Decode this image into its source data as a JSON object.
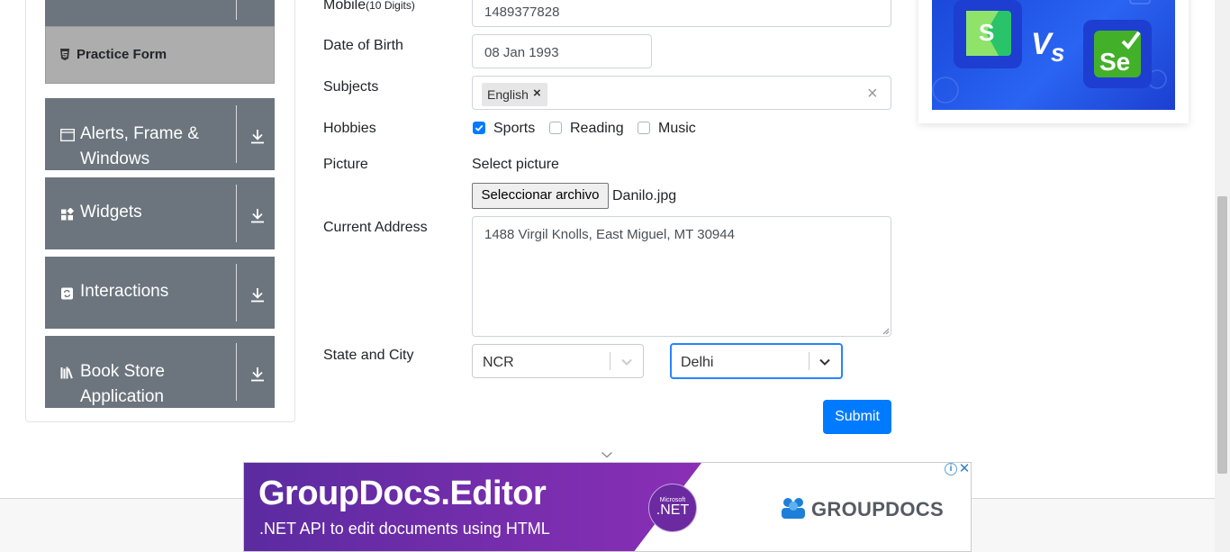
{
  "sidebar": {
    "practice_form_label": "Practice Form",
    "groups": [
      {
        "label_line1": "Alerts, Frame &",
        "label_line2": "Windows",
        "icon": "window-icon"
      },
      {
        "label_line1": "Widgets",
        "icon": "widgets-icon"
      },
      {
        "label_line1": "Interactions",
        "icon": "interactions-icon"
      },
      {
        "label_line1": "Book Store",
        "label_line2": "Application",
        "icon": "book-icon"
      }
    ]
  },
  "form": {
    "mobile_label": "Mobile",
    "mobile_hint": "(10 Digits)",
    "mobile_value": "1489377828",
    "dob_label": "Date of Birth",
    "dob_value": "08 Jan 1993",
    "subjects_label": "Subjects",
    "subjects": [
      "English"
    ],
    "hobbies_label": "Hobbies",
    "hobbies": [
      {
        "label": "Sports",
        "checked": true
      },
      {
        "label": "Reading",
        "checked": false
      },
      {
        "label": "Music",
        "checked": false
      }
    ],
    "picture_label": "Picture",
    "picture_prompt": "Select picture",
    "file_button": "Seleccionar archivo",
    "file_name": "Danilo.jpg",
    "address_label": "Current Address",
    "address_value": "1488 Virgil Knolls, East Miguel, MT 30944",
    "state_city_label": "State and City",
    "state_value": "NCR",
    "city_value": "Delhi",
    "submit_label": "Submit"
  },
  "bottom_ad": {
    "title": "GroupDocs.Editor",
    "subtitle": ".NET API to edit documents using HTML",
    "badge_small": "Microsoft",
    "badge_main": ".NET",
    "brand": "GROUPDOCS"
  },
  "colors": {
    "sidebar_group": "#6c757d",
    "active_item": "#adadad",
    "primary": "#007bff",
    "ad_purple": "#6c2aa8"
  }
}
